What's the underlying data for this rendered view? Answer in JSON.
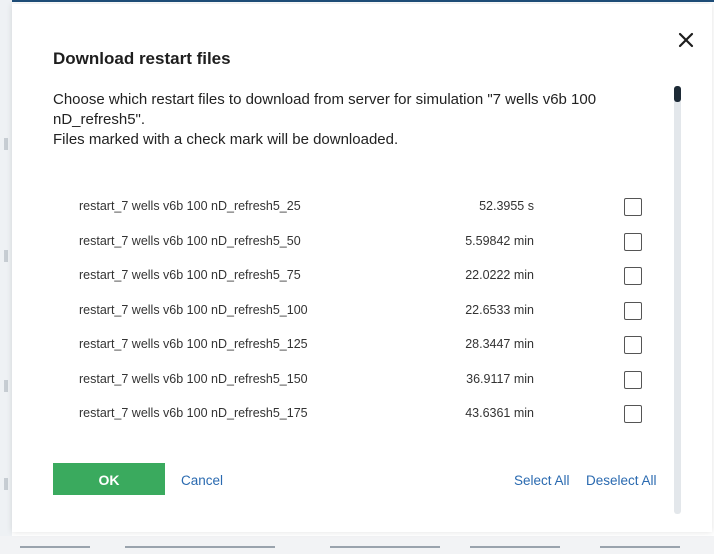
{
  "dialog": {
    "title": "Download restart files",
    "description_line1": "Choose which restart files to download from server for simulation \"7 wells v6b 100 nD_refresh5\".",
    "description_line2": "Files marked with a check mark will be downloaded.",
    "close_icon": "close-icon"
  },
  "files": [
    {
      "name": "restart_7 wells v6b 100 nD_refresh5_25",
      "time": "52.3955 s",
      "checked": false
    },
    {
      "name": "restart_7 wells v6b 100 nD_refresh5_50",
      "time": "5.59842 min",
      "checked": false
    },
    {
      "name": "restart_7 wells v6b 100 nD_refresh5_75",
      "time": "22.0222 min",
      "checked": false
    },
    {
      "name": "restart_7 wells v6b 100 nD_refresh5_100",
      "time": "22.6533 min",
      "checked": false
    },
    {
      "name": "restart_7 wells v6b 100 nD_refresh5_125",
      "time": "28.3447 min",
      "checked": false
    },
    {
      "name": "restart_7 wells v6b 100 nD_refresh5_150",
      "time": "36.9117 min",
      "checked": false
    },
    {
      "name": "restart_7 wells v6b 100 nD_refresh5_175",
      "time": "43.6361 min",
      "checked": false
    }
  ],
  "actions": {
    "ok_label": "OK",
    "cancel_label": "Cancel",
    "select_all_label": "Select All",
    "deselect_all_label": "Deselect All"
  },
  "colors": {
    "ok_button": "#3aaa5e",
    "link": "#2a6ab0",
    "scroll_thumb": "#1d2a36"
  }
}
